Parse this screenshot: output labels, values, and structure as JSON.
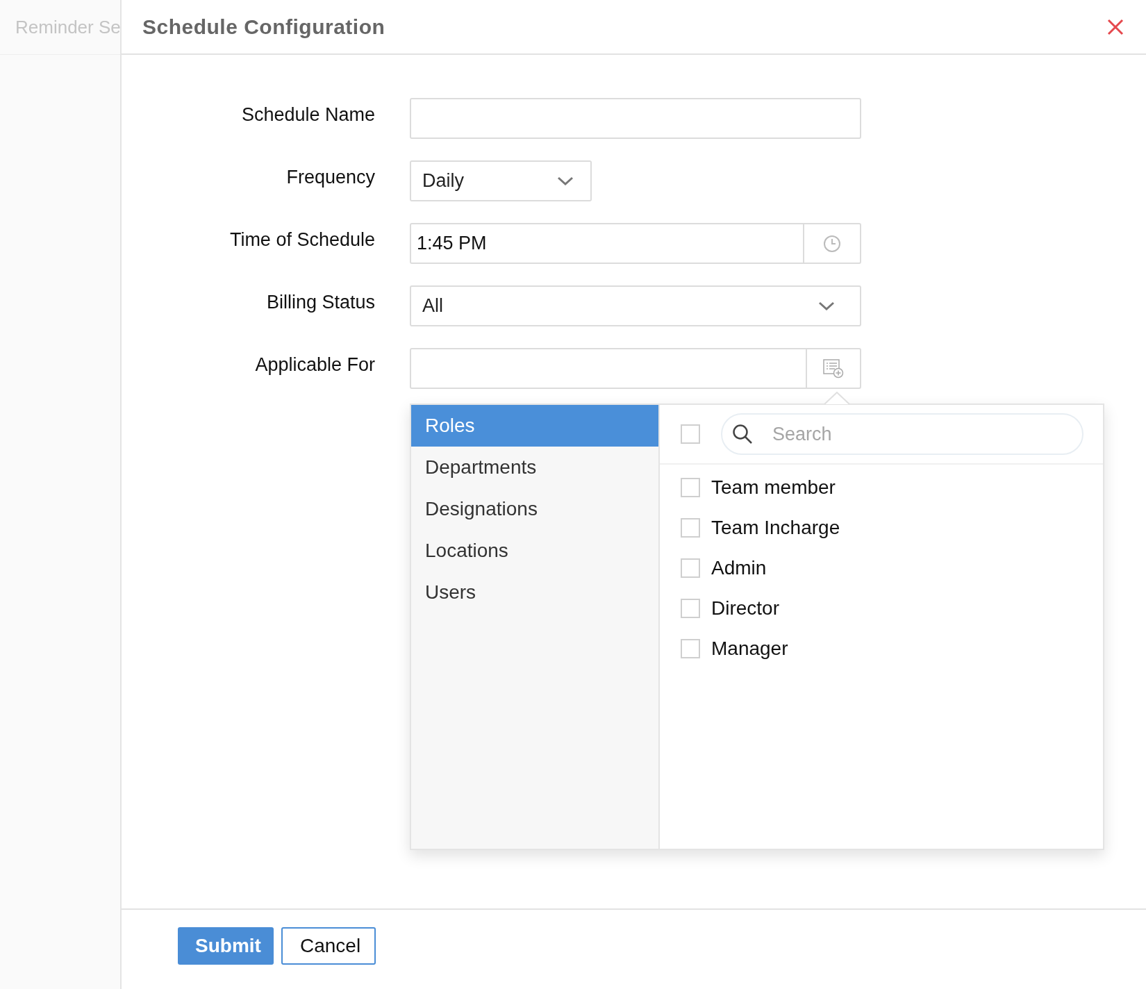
{
  "background": {
    "title": "Reminder Se"
  },
  "dialog": {
    "title": "Schedule Configuration"
  },
  "fields": [
    {
      "kind": "text",
      "label": "Schedule Name"
    },
    {
      "kind": "select",
      "label": "Frequency",
      "value": "Daily"
    },
    {
      "kind": "time",
      "label": "Time of Schedule",
      "value": "1:45 PM"
    },
    {
      "kind": "wideselect",
      "label": "Billing Status",
      "value": "All"
    },
    {
      "kind": "picker",
      "label": "Applicable For"
    }
  ],
  "picker": {
    "categories": [
      {
        "label": "Roles",
        "selected": true
      },
      {
        "label": "Departments",
        "selected": false
      },
      {
        "label": "Designations",
        "selected": false
      },
      {
        "label": "Locations",
        "selected": false
      },
      {
        "label": "Users",
        "selected": false
      }
    ],
    "select_all": {
      "checked": false
    },
    "search": {
      "placeholder": "Search"
    },
    "options": [
      {
        "label": "Team member",
        "checked": false
      },
      {
        "label": "Team Incharge",
        "checked": false
      },
      {
        "label": "Admin",
        "checked": false
      },
      {
        "label": "Director",
        "checked": false
      },
      {
        "label": "Manager",
        "checked": false
      }
    ]
  },
  "buttons": [
    {
      "label": "Submit",
      "kind": "primary"
    },
    {
      "label": "Cancel",
      "kind": "secondary"
    }
  ]
}
